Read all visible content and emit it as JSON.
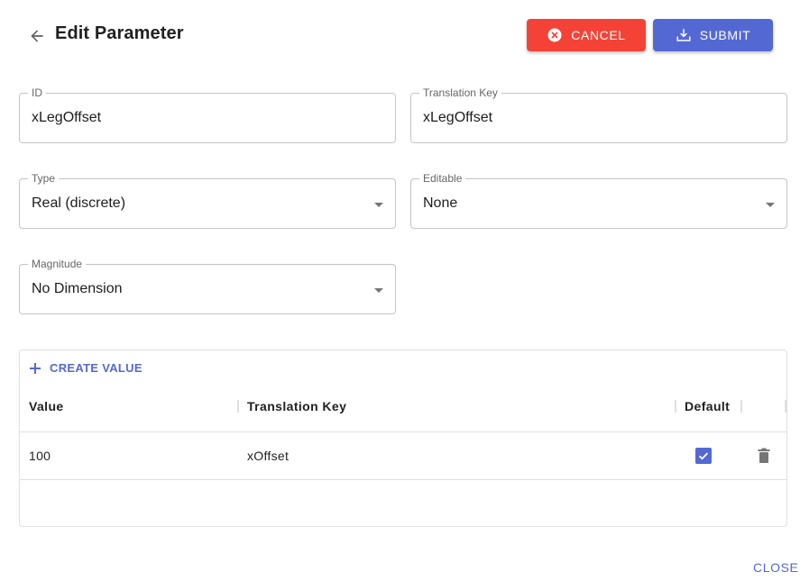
{
  "header": {
    "title": "Edit Parameter",
    "cancel_label": "CANCEL",
    "submit_label": "SUBMIT"
  },
  "form": {
    "id": {
      "label": "ID",
      "value": "xLegOffset"
    },
    "translation_key": {
      "label": "Translation Key",
      "value": "xLegOffset"
    },
    "type": {
      "label": "Type",
      "value": "Real (discrete)"
    },
    "editable": {
      "label": "Editable",
      "value": "None"
    },
    "magnitude": {
      "label": "Magnitude",
      "value": "No Dimension"
    }
  },
  "values_table": {
    "create_label": "CREATE VALUE",
    "columns": [
      "Value",
      "Translation Key",
      "Default"
    ],
    "rows": [
      {
        "value": "100",
        "translation_key": "xOffset",
        "default": true
      }
    ]
  },
  "footer": {
    "close_label": "CLOSE"
  },
  "colors": {
    "primary": "#5468d4",
    "danger": "#f44336"
  }
}
